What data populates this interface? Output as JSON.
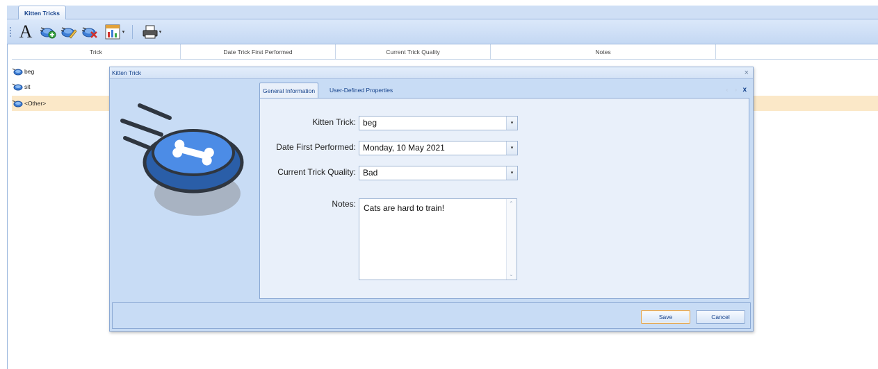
{
  "document_tab": {
    "label": "Kitten Tricks"
  },
  "toolbar": {
    "items": [
      {
        "name": "font",
        "glyph": "A"
      },
      {
        "name": "add"
      },
      {
        "name": "edit"
      },
      {
        "name": "delete"
      },
      {
        "name": "chart"
      },
      {
        "name": "print"
      }
    ]
  },
  "grid": {
    "columns": [
      "Trick",
      "Date Trick First Performed",
      "Current Trick Quality",
      "Notes"
    ],
    "rows": [
      {
        "label": "beg",
        "selected": false
      },
      {
        "label": "sit",
        "selected": false
      },
      {
        "label": "<Other>",
        "selected": true
      }
    ]
  },
  "dialog": {
    "title": "Kitten Trick",
    "close_glyph": "×",
    "tabs": [
      {
        "label": "General Information",
        "active": true
      },
      {
        "label": "User-Defined Properties",
        "active": false
      }
    ],
    "tab_close_glyph": "x",
    "fields": {
      "kitten_trick": {
        "label": "Kitten Trick:",
        "value": "beg"
      },
      "date_first_performed": {
        "label": "Date First Performed:",
        "value": "Monday, 10 May 2021"
      },
      "current_trick_quality": {
        "label": "Current Trick Quality:",
        "value": "Bad"
      },
      "notes": {
        "label": "Notes:",
        "value": "Cats are hard to train!"
      }
    },
    "buttons": {
      "save": "Save",
      "cancel": "Cancel"
    }
  },
  "colors": {
    "accent": "#15428b",
    "panel": "#c8dcf5",
    "selected_row": "#fbe8c8",
    "bowl": "#3f7fd6"
  }
}
